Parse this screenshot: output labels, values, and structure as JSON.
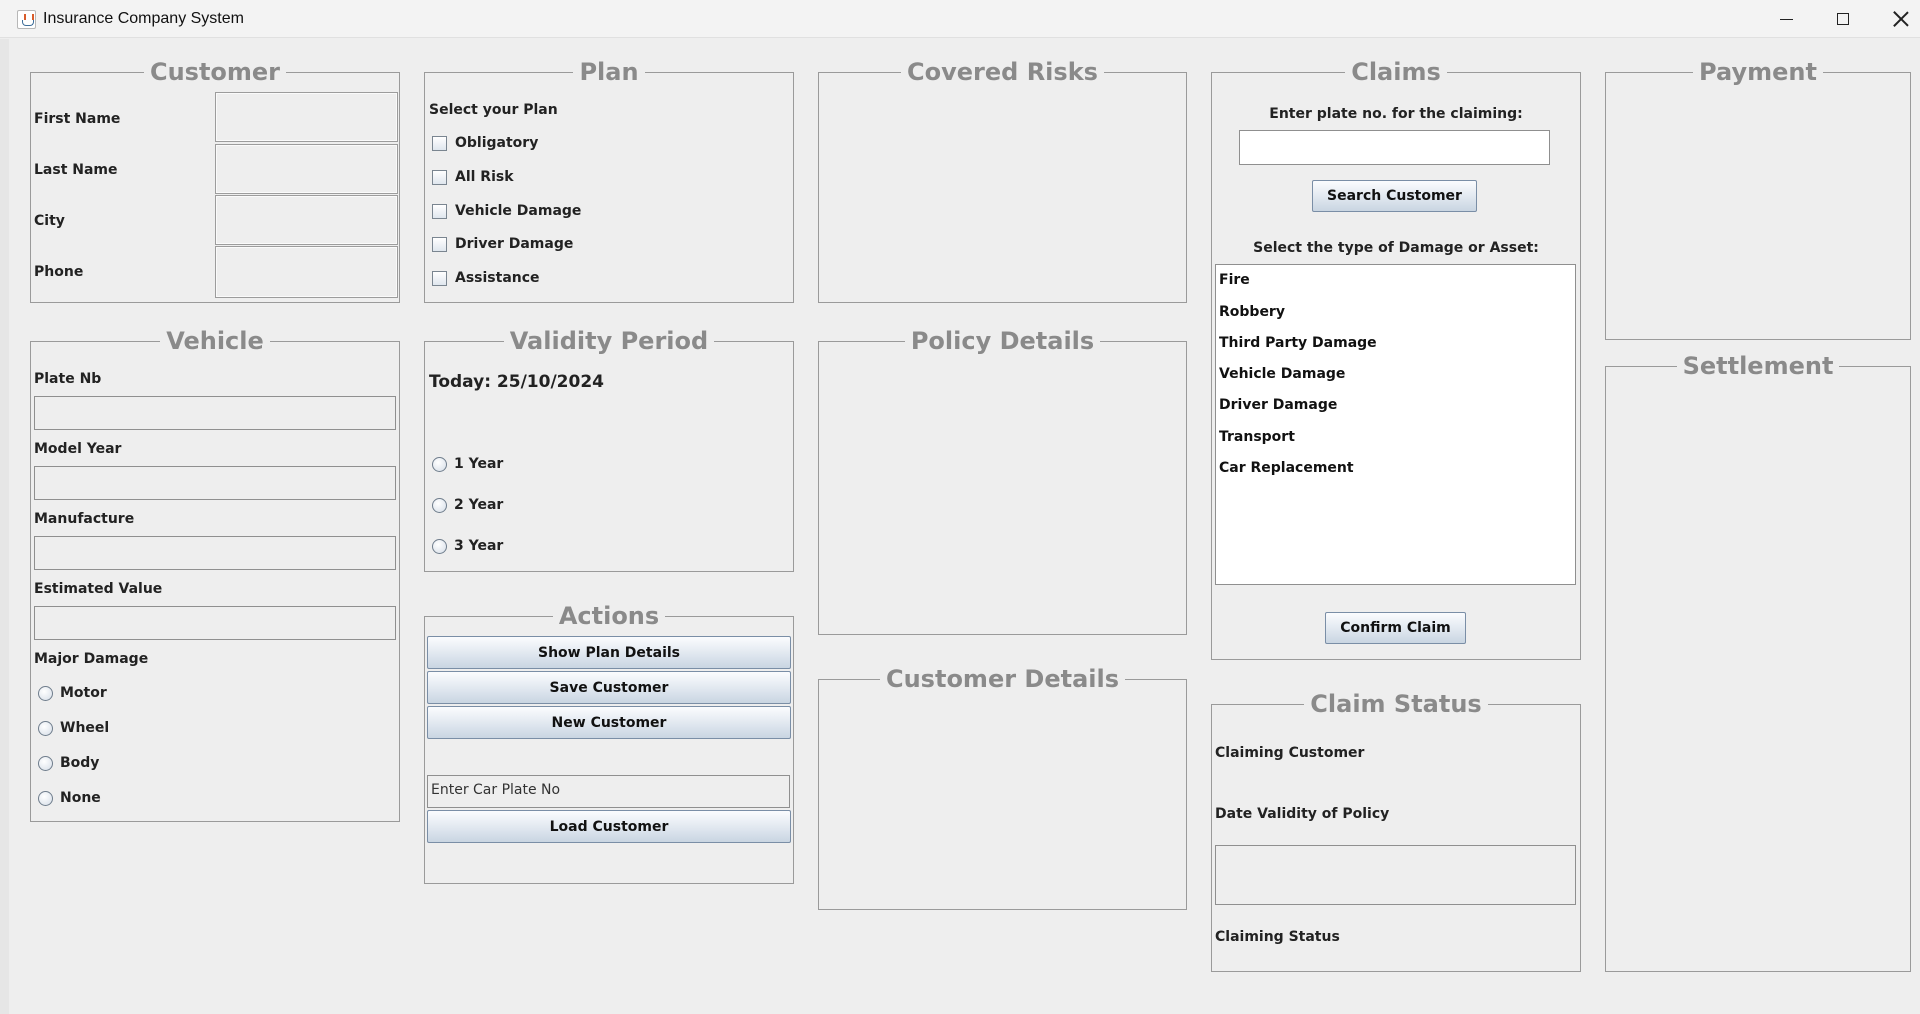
{
  "window": {
    "title": "Insurance Company System"
  },
  "customer": {
    "title": "Customer",
    "first_name_label": "First Name",
    "last_name_label": "Last Name",
    "city_label": "City",
    "phone_label": "Phone"
  },
  "vehicle": {
    "title": "Vehicle",
    "plate_label": "Plate Nb",
    "model_year_label": "Model Year",
    "manufacture_label": "Manufacture",
    "estimated_value_label": "Estimated Value",
    "major_damage_label": "Major Damage",
    "damage_options": [
      "Motor",
      "Wheel",
      "Body",
      "None"
    ]
  },
  "plan": {
    "title": "Plan",
    "select_label": "Select your Plan",
    "options": [
      "Obligatory",
      "All Risk",
      "Vehicle Damage",
      "Driver Damage",
      "Assistance"
    ]
  },
  "validity": {
    "title": "Validity Period",
    "today": "Today: 25/10/2024",
    "options": [
      "1 Year",
      "2 Year",
      "3 Year"
    ]
  },
  "actions": {
    "title": "Actions",
    "show_plan_details": "Show Plan Details",
    "save_customer": "Save Customer",
    "new_customer": "New Customer",
    "plate_placeholder": "Enter Car Plate No",
    "load_customer": "Load Customer"
  },
  "covered_risks": {
    "title": "Covered Risks"
  },
  "policy_details": {
    "title": "Policy Details"
  },
  "customer_details": {
    "title": "Customer Details"
  },
  "claims": {
    "title": "Claims",
    "plate_prompt": "Enter plate no. for the claiming:",
    "search_button": "Search Customer",
    "damage_type_label": "Select the type of Damage or Asset:",
    "damage_types": [
      "Fire",
      "Robbery",
      "Third Party Damage",
      "Vehicle Damage",
      "Driver Damage",
      "Transport",
      "Car Replacement"
    ],
    "confirm_button": "Confirm Claim"
  },
  "claim_status": {
    "title": "Claim Status",
    "claiming_customer_label": "Claiming Customer",
    "date_validity_label": "Date Validity of Policy",
    "claiming_status_label": "Claiming Status"
  },
  "payment": {
    "title": "Payment"
  },
  "settlement": {
    "title": "Settlement"
  }
}
